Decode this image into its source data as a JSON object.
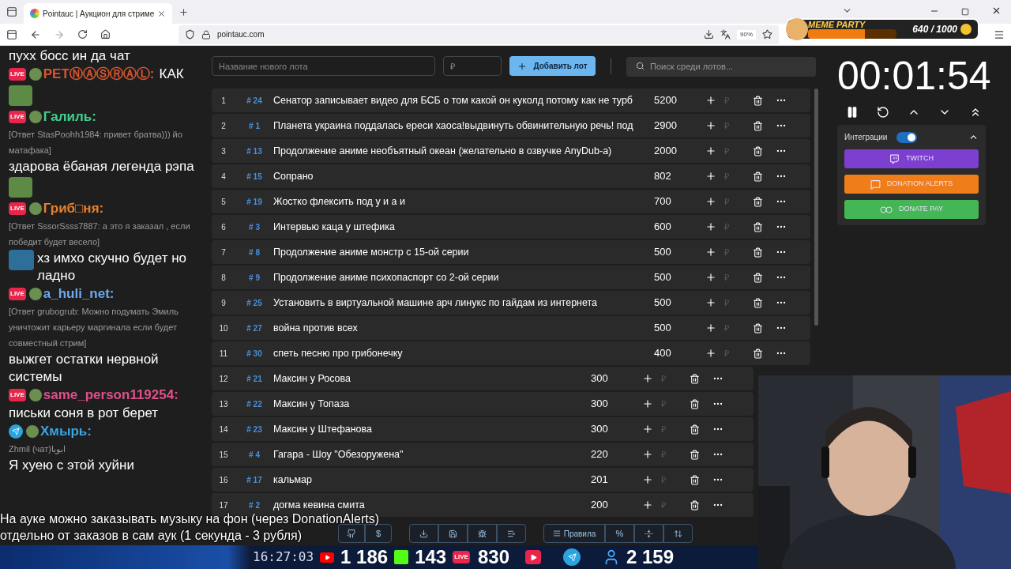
{
  "browser": {
    "tab_title": "Pointauc | Аукцион для стриме",
    "url": "pointauc.com",
    "zoom": "90%"
  },
  "meme_party": {
    "title": "MEME PARTY",
    "count": "640 / 1000",
    "level": 0.64
  },
  "chat": {
    "top_text": "пухх босс ин да чат",
    "messages": [
      {
        "kind": "inline",
        "source": {
          "kind": "live",
          "label": "LIVE"
        },
        "name": "PETⓃⒶⓈⓇⒶⓁ:",
        "color": "#d9552f",
        "text": "КАК",
        "emote_below": true
      },
      {
        "kind": "block",
        "source": {
          "kind": "live",
          "label": "LIVE"
        },
        "name": "Галиль:",
        "color": "#3fcf8e",
        "reply": "[Ответ StasPoohh1984: привет братва))) йо матафака]",
        "text": "здарова ёбаная легенда рэпа",
        "emote_below": true
      },
      {
        "kind": "block",
        "source": {
          "kind": "live",
          "label": "LIVE"
        },
        "name": "Гриб□ня:",
        "color": "#e8802c",
        "reply": "[Ответ SssorSsss7887: а это я заказал , если победит будет весело]",
        "text": "хз имхо скучно будет но ладно",
        "emote_inline": true
      },
      {
        "kind": "block",
        "source": {
          "kind": "live",
          "label": "LIVE"
        },
        "name": "a_huli_net:",
        "color": "#6aaaf0",
        "reply": "[Ответ grubogrub: Можно подумать Эмиль уничтожит карьеру маргинала если будет совместный стрим]",
        "text": "выжгет остатки нервной системы"
      },
      {
        "kind": "block",
        "source": {
          "kind": "live",
          "label": "LIVE"
        },
        "name": "same_person119254:",
        "color": "#e0508a",
        "text": "письки соня в рот берет"
      },
      {
        "kind": "block",
        "source": {
          "kind": "telegram"
        },
        "name": "Хмырь:",
        "color": "#3ba3e0",
        "reply": "Zhmil (чат)ابويا",
        "text": "Я хуею с этой хуйни"
      }
    ]
  },
  "new_lot": {
    "name_placeholder": "Название нового лота",
    "amount_placeholder": "₽",
    "add_button": "Добавить лот",
    "search_placeholder": "Поиск среди лотов..."
  },
  "lots": [
    {
      "index": "1",
      "id": "# 24",
      "name": "Сенатор записывает видео для БСБ о том какой он куколд потому как не турб",
      "amount": "5200"
    },
    {
      "index": "2",
      "id": "# 1",
      "name": "Планета украина поддалась ереси хаоса!выдвинуть обвинительную речь! под",
      "amount": "2900"
    },
    {
      "index": "3",
      "id": "# 13",
      "name": "Продолжение аниме необъятный океан (желательно в озвучке AnyDub-а)",
      "amount": "2000"
    },
    {
      "index": "4",
      "id": "# 15",
      "name": "Сопрано",
      "amount": "802"
    },
    {
      "index": "5",
      "id": "# 19",
      "name": "Жостко флексить под у и а и",
      "amount": "700"
    },
    {
      "index": "6",
      "id": "# 3",
      "name": "Интервью каца у штефика",
      "amount": "600"
    },
    {
      "index": "7",
      "id": "# 8",
      "name": "Продолжение аниме монстр с 15-ой серии",
      "amount": "500"
    },
    {
      "index": "8",
      "id": "# 9",
      "name": "Продолжение аниме психопаспорт со 2-ой серии",
      "amount": "500"
    },
    {
      "index": "9",
      "id": "# 25",
      "name": "Установить в виртуальной машине арч линукс по гайдам из интернета",
      "amount": "500"
    },
    {
      "index": "10",
      "id": "# 27",
      "name": "война против всех",
      "amount": "500"
    },
    {
      "index": "11",
      "id": "# 30",
      "name": "спеть песню про грибонечку",
      "amount": "400"
    },
    {
      "index": "12",
      "id": "# 21",
      "name": "Максин у Росова",
      "amount": "300"
    },
    {
      "index": "13",
      "id": "# 22",
      "name": "Максин у Топаза",
      "amount": "300"
    },
    {
      "index": "14",
      "id": "# 23",
      "name": "Максин у Штефанова",
      "amount": "300"
    },
    {
      "index": "15",
      "id": "# 4",
      "name": "Гагара - Шоу \"Обезоружена\"",
      "amount": "220"
    },
    {
      "index": "16",
      "id": "# 17",
      "name": "кальмар",
      "amount": "201"
    },
    {
      "index": "17",
      "id": "# 2",
      "name": "догма кевина смита",
      "amount": "200"
    }
  ],
  "currency_placeholder": "₽",
  "timer": "00:01:54",
  "integrations": {
    "label": "Интеграции",
    "on": true,
    "expanded": true,
    "buttons": [
      {
        "kind": "twitch",
        "label": "TWITCH"
      },
      {
        "kind": "donation_alerts",
        "label": "DONATION ALERTS"
      },
      {
        "kind": "donate_pay",
        "label": "DONATE PAY"
      }
    ]
  },
  "caption": [
    "На ауке можно заказывать музыку на фон (через DonationAlerts)",
    "отдельно от заказов в сам аук (1 секунда - 3 рубля)"
  ],
  "toolbar": {
    "rules_button": "Правила",
    "dollar_button": "$",
    "percent_button": "%"
  },
  "stream_stats": {
    "time": "16:27:03",
    "youtube": "1 186",
    "kick": "143",
    "live_badge": "LIVE",
    "live": "830",
    "viewers": "2 159"
  }
}
